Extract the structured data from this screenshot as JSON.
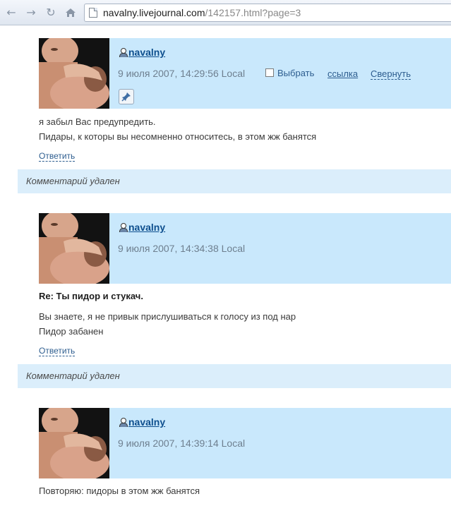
{
  "browser": {
    "url_host": "navalny.livejournal.com",
    "url_path": "/142157.html?page=3"
  },
  "comments": [
    {
      "username": "navalny",
      "date": "9 июля 2007, 14:29:56 Local",
      "select_label": "Выбрать",
      "link_label": "ссылка",
      "collapse_label": "Свернуть",
      "subject": "",
      "body": [
        "я забыл Вас предупредить.",
        "Пидары, к которы вы несомненно относитесь, в этом жж банятся"
      ],
      "reply_label": "Ответить"
    },
    {
      "username": "navalny",
      "date": "9 июля 2007, 14:34:38 Local",
      "subject": "Re: Ты пидор и стукач.",
      "body": [
        "Вы знаете, я не привык прислушиваться к голосу из под нар",
        "Пидор забанен"
      ],
      "reply_label": "Ответить"
    },
    {
      "username": "navalny",
      "date": "9 июля 2007, 14:39:14 Local",
      "subject": "",
      "body": [
        "Повторяю: пидоры в этом жж банятся"
      ]
    }
  ],
  "deleted_notices": [
    "Комментарий удален",
    "Комментарий удален"
  ],
  "colors": {
    "header_bg": "#c9e8fc",
    "deleted_bg": "#dbeefb",
    "link": "#2d5d8f",
    "username": "#0e4f8e"
  },
  "icons": [
    "back-icon",
    "forward-icon",
    "reload-icon",
    "home-icon",
    "page-icon",
    "user-icon",
    "pin-icon"
  ]
}
